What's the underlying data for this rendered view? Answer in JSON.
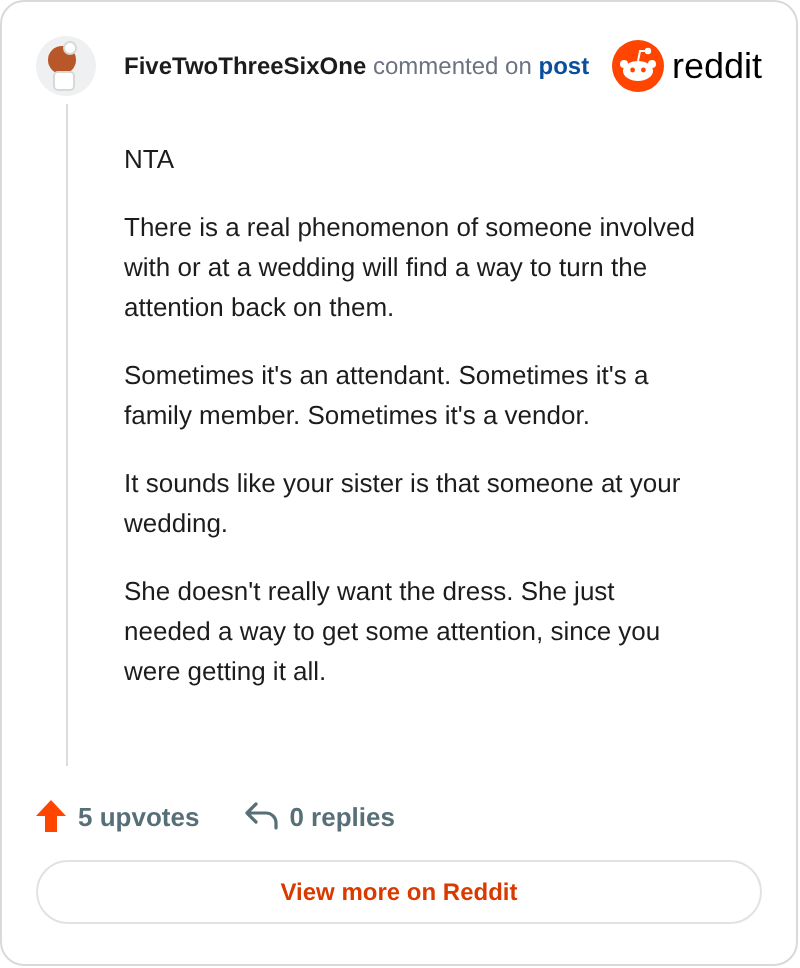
{
  "comment": {
    "author": "FiveTwoThreeSixOne",
    "action": "commented on",
    "link": "post",
    "paragraphs": [
      "NTA",
      "There is a real phenomenon of someone involved with or at a wedding will find a way to turn the attention back on them.",
      "Sometimes it's an attendant. Sometimes it's a family member. Sometimes it's a vendor.",
      "It sounds like your sister is that someone at your wedding.",
      "She doesn't really want the dress. She just needed a way to get some attention, since you were getting it all."
    ]
  },
  "logo": {
    "text": "reddit"
  },
  "stats": {
    "upvotes": "5 upvotes",
    "replies": "0 replies"
  },
  "button": {
    "label": "View more on Reddit"
  }
}
